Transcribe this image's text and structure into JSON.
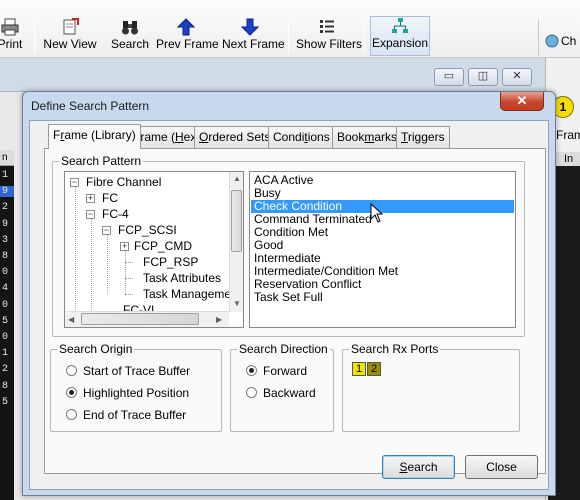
{
  "toolbar": {
    "items": [
      {
        "label": "Print",
        "icon": "print-icon"
      },
      {
        "label": "New View",
        "icon": "new-view-icon"
      },
      {
        "label": "Search",
        "icon": "binoculars-icon"
      },
      {
        "label": "Prev Frame",
        "icon": "up-arrow-icon"
      },
      {
        "label": "Next Frame",
        "icon": "down-arrow-icon"
      },
      {
        "label": "Show Filters",
        "icon": "filter-list-icon"
      },
      {
        "label": "Expansion",
        "icon": "expansion-tree-icon"
      }
    ],
    "right_label": "Ch"
  },
  "background": {
    "right_panel_badge": "1",
    "right_panel_label": "Frame",
    "right_panel_col": "In",
    "left_header": "n",
    "left_numbers": [
      "1",
      "9",
      "2",
      "9",
      "3",
      "8",
      "0",
      "4",
      "0",
      "5",
      "0",
      "1",
      "2",
      "8",
      "5"
    ]
  },
  "dialog": {
    "title": "Define Search Pattern",
    "close": "✕",
    "tabs": [
      "Frame (Library)",
      "Frame (Hex)",
      "Ordered Sets",
      "Conditions",
      "Bookmarks",
      "Triggers"
    ],
    "search_pattern": {
      "label": "Search Pattern",
      "tree": [
        {
          "label": "Fibre Channel",
          "expander": "−"
        },
        {
          "label": "FC",
          "expander": "+"
        },
        {
          "label": "FC-4",
          "expander": "−"
        },
        {
          "label": "FCP_SCSI",
          "expander": "−"
        },
        {
          "label": "FCP_CMD",
          "expander": "+"
        },
        {
          "label": "FCP_RSP",
          "expander": ""
        },
        {
          "label": "Task Attributes",
          "expander": ""
        },
        {
          "label": "Task Managemer",
          "expander": ""
        },
        {
          "label": "FC-VI",
          "expander": ""
        }
      ],
      "list": [
        "ACA Active",
        "Busy",
        "Check Condition",
        "Command Terminated",
        "Condition Met",
        "Good",
        "Intermediate",
        "Intermediate/Condition Met",
        "Reservation Conflict",
        "Task Set Full"
      ],
      "selected": "Check Condition"
    },
    "search_origin": {
      "label": "Search Origin",
      "options": [
        "Start of Trace Buffer",
        "Highlighted Position",
        "End of Trace Buffer"
      ],
      "selected_index": 1
    },
    "search_direction": {
      "label": "Search Direction",
      "options": [
        "Forward",
        "Backward"
      ],
      "selected_index": 0
    },
    "search_rx_ports": {
      "label": "Search Rx Ports",
      "ports": [
        "1",
        "2"
      ],
      "colors": [
        "#f2e200",
        "#9a8d00"
      ]
    },
    "buttons": {
      "search": "Search",
      "close": "Close"
    }
  }
}
